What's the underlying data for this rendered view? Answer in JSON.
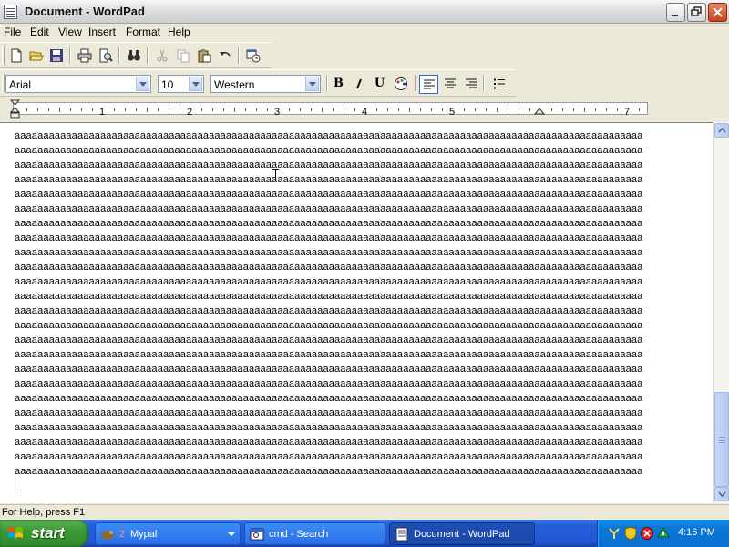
{
  "window": {
    "title": "Document - WordPad"
  },
  "menu": [
    "File",
    "Edit",
    "View",
    "Insert",
    "Format",
    "Help"
  ],
  "format_bar": {
    "font": "Arial",
    "size": "10",
    "script": "Western"
  },
  "ruler_numbers": [
    "1",
    "2",
    "3",
    "4",
    "5",
    "7"
  ],
  "document": {
    "line_text": "aaaaaaaaaaaaaaaaaaaaaaaaaaaaaaaaaaaaaaaaaaaaaaaaaaaaaaaaaaaaaaaaaaaaaaaaaaaaaaaaaaaaaaaaaaaaaaaaaaaaaaaaaaaaaa",
    "line_count": 24
  },
  "status": {
    "text": "For Help, press F1"
  },
  "taskbar": {
    "start_label": "start",
    "tasks": [
      {
        "label": "Mypal",
        "badge": "2"
      },
      {
        "label": "cmd - Search"
      },
      {
        "label": "Document - WordPad"
      }
    ],
    "clock": "4:16 PM"
  },
  "colors": {
    "taskbar": "#245edb",
    "start": "#3c9a36",
    "tray": "#0a78d8"
  }
}
